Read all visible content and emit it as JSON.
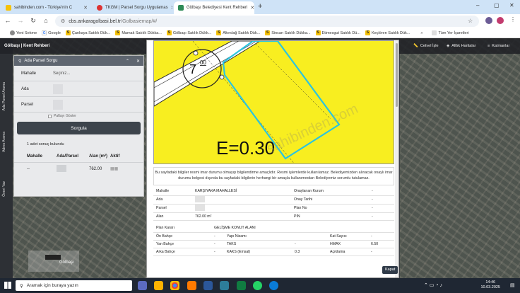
{
  "browser": {
    "tabs": [
      {
        "title": "sahibinden.com - Türkiye'nin C",
        "color": "#f6c20a"
      },
      {
        "title": "TKGM | Parsel Sorgu Uygulamas",
        "color": "#d33"
      },
      {
        "title": "Gölbaşı Belediyesi Kent Rehberi",
        "color": "#2e8b57"
      }
    ],
    "url_host": "cbs.ankaragolbasi.bel.tr",
    "url_path": "/Golbasiemap/#/",
    "bookmarks": [
      "Yeni Sekme",
      "Google",
      "Çankaya Satılık Dük...",
      "Mamak Satılık Dükka...",
      "Gölbaşı Satılık Dükk...",
      "Altındağ Satılık Dük...",
      "Sincan Satılık Dükka...",
      "Etimesgut Satılık Dü...",
      "Keçiören Satılık Dük..."
    ],
    "all_bookmarks": "Tüm Yer İşaretleri"
  },
  "app": {
    "brand": "Gölbaşı | Kent Rehberi",
    "side_labels": [
      "Ada Parsel Arama",
      "Adres Arama",
      "Öneri Yaz"
    ],
    "panel": {
      "title": "Ada Parsel Sorgu",
      "mahalle_label": "Mahalle",
      "mahalle_value": "Seçiniz...",
      "ada_label": "Ada",
      "parsel_label": "Parsel",
      "checkbox_label": "Paftayı Göster",
      "search_button": "Sorgula",
      "result_count": "1 adet sonuç bulundu",
      "cols": [
        "Mahalle",
        "Ada/Parsel",
        "Alan (m²)",
        "Aktif"
      ],
      "row": {
        "mahalle": "--",
        "alan": "762.00"
      }
    },
    "map_tools": [
      "Cetvel İşle",
      "Altlık Haritalar",
      "Katmanlar"
    ],
    "map_label": "Gölbaşı",
    "plan": {
      "number": "7",
      "sup": "00",
      "emsal": "E=0.30",
      "watermark": "sahibinden.com"
    },
    "notice": "Bu sayfadaki bilgiler resmi imar durumu olmayıp bilgilendirme amaçlıdır. Resmi işlemlerde kullanılamaz. Belediyemizden alınacak onaylı imar durumu belgesi dışında bu sayfadaki bilgilerin herhangi bir amaçla kullanımından Belediyemiz sorumlu tutulamaz.",
    "info1": [
      [
        "Mahalle",
        "KARŞIYAKA MAHALLESİ",
        "Onaylanan Kurum",
        "-"
      ],
      [
        "Ada",
        "",
        "Onay Tarihi",
        "-"
      ],
      [
        "Parsel",
        "",
        "Plan No",
        "-"
      ],
      [
        "Alan",
        "762.00 m²",
        "PIN",
        "-"
      ]
    ],
    "info2_header": [
      "Plan Kararı",
      "GELİŞME KONUT ALANI"
    ],
    "info2": [
      [
        "Ön Bahçe",
        "-",
        "Yapı Nizamı",
        "",
        "Kat Sayısı",
        "-"
      ],
      [
        "Yan Bahçe",
        "-",
        "TAKS",
        "-",
        "HMAX",
        "6.50"
      ],
      [
        "Arka Bahçe",
        "-",
        "KAKS (Emsal)",
        "0.3",
        "Açıklama",
        "-"
      ]
    ],
    "close_button": "Kapat"
  },
  "taskbar": {
    "search_placeholder": "Aramak için buraya yazın",
    "time": "14:46",
    "date": "10.03.2025",
    "weather": ""
  }
}
